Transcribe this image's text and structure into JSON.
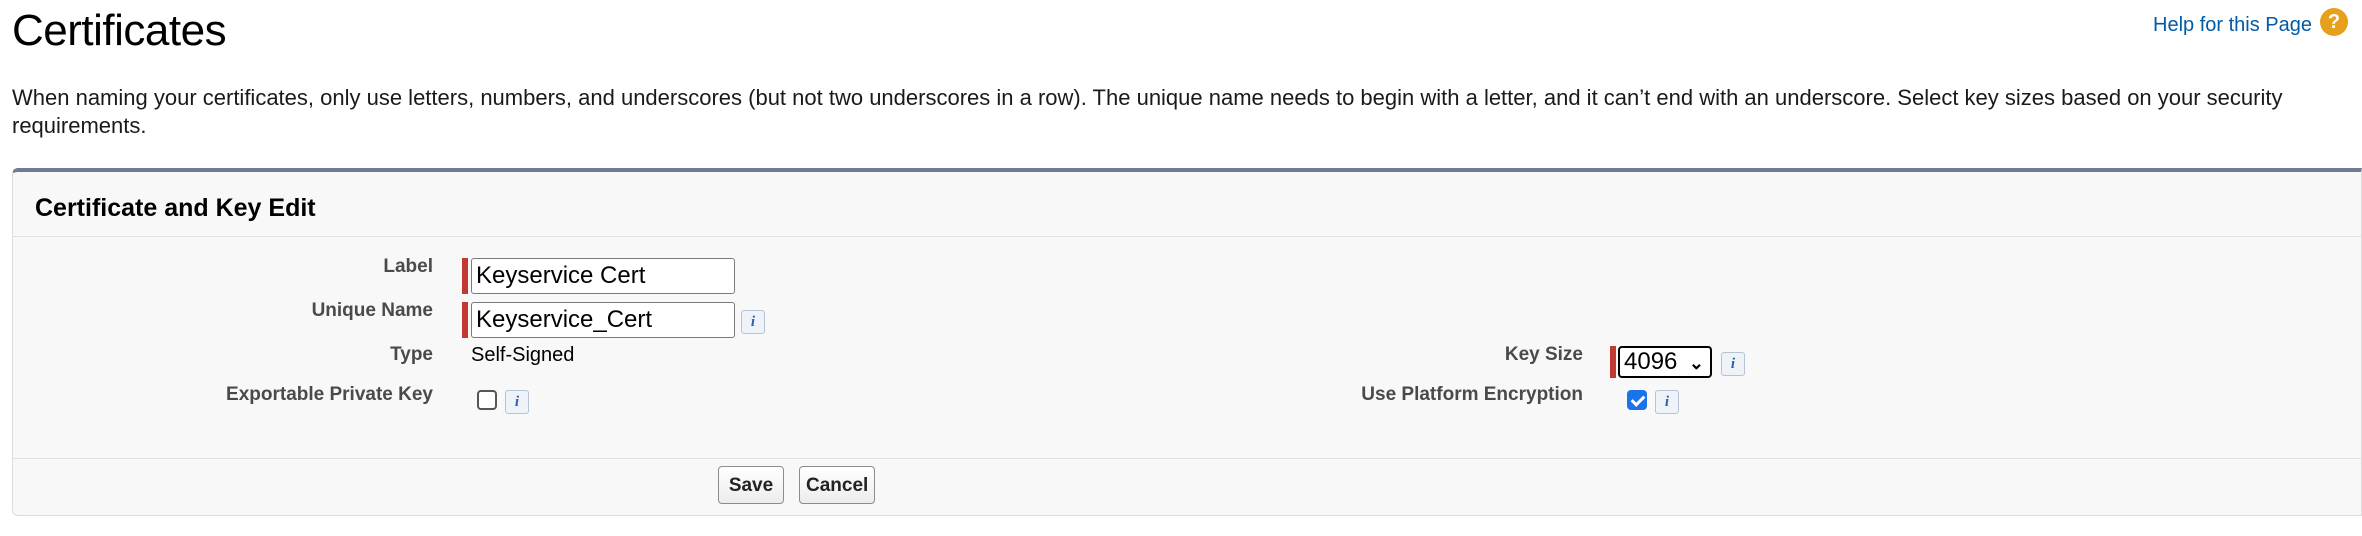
{
  "header": {
    "title": "Certificates",
    "help_link": "Help for this Page",
    "help_icon": "question-icon"
  },
  "intro": "When naming your certificates, only use letters, numbers, and underscores (but not two underscores in a row). The unique name needs to begin with a letter, and it can’t end with an underscore. Select key sizes based on your security requirements.",
  "section": {
    "title": "Certificate and Key Edit",
    "fields": {
      "label": {
        "label": "Label",
        "value": "Keyservice Cert",
        "required": true
      },
      "unique_name": {
        "label": "Unique Name",
        "value": "Keyservice_Cert",
        "required": true
      },
      "type": {
        "label": "Type",
        "value": "Self-Signed"
      },
      "exportable_private_key": {
        "label": "Exportable Private Key",
        "checked": false
      },
      "key_size": {
        "label": "Key Size",
        "value": "4096",
        "required": true
      },
      "use_platform_encryption": {
        "label": "Use Platform Encryption",
        "checked": true
      }
    },
    "info_icon": "i",
    "buttons": {
      "save": "Save",
      "cancel": "Cancel"
    }
  },
  "colors": {
    "required_bar": "#c23934",
    "link": "#015ba7",
    "help_icon": "#e6a01c",
    "panel_top_border": "#6f7c94",
    "checkbox_checked": "#1a73e8"
  }
}
